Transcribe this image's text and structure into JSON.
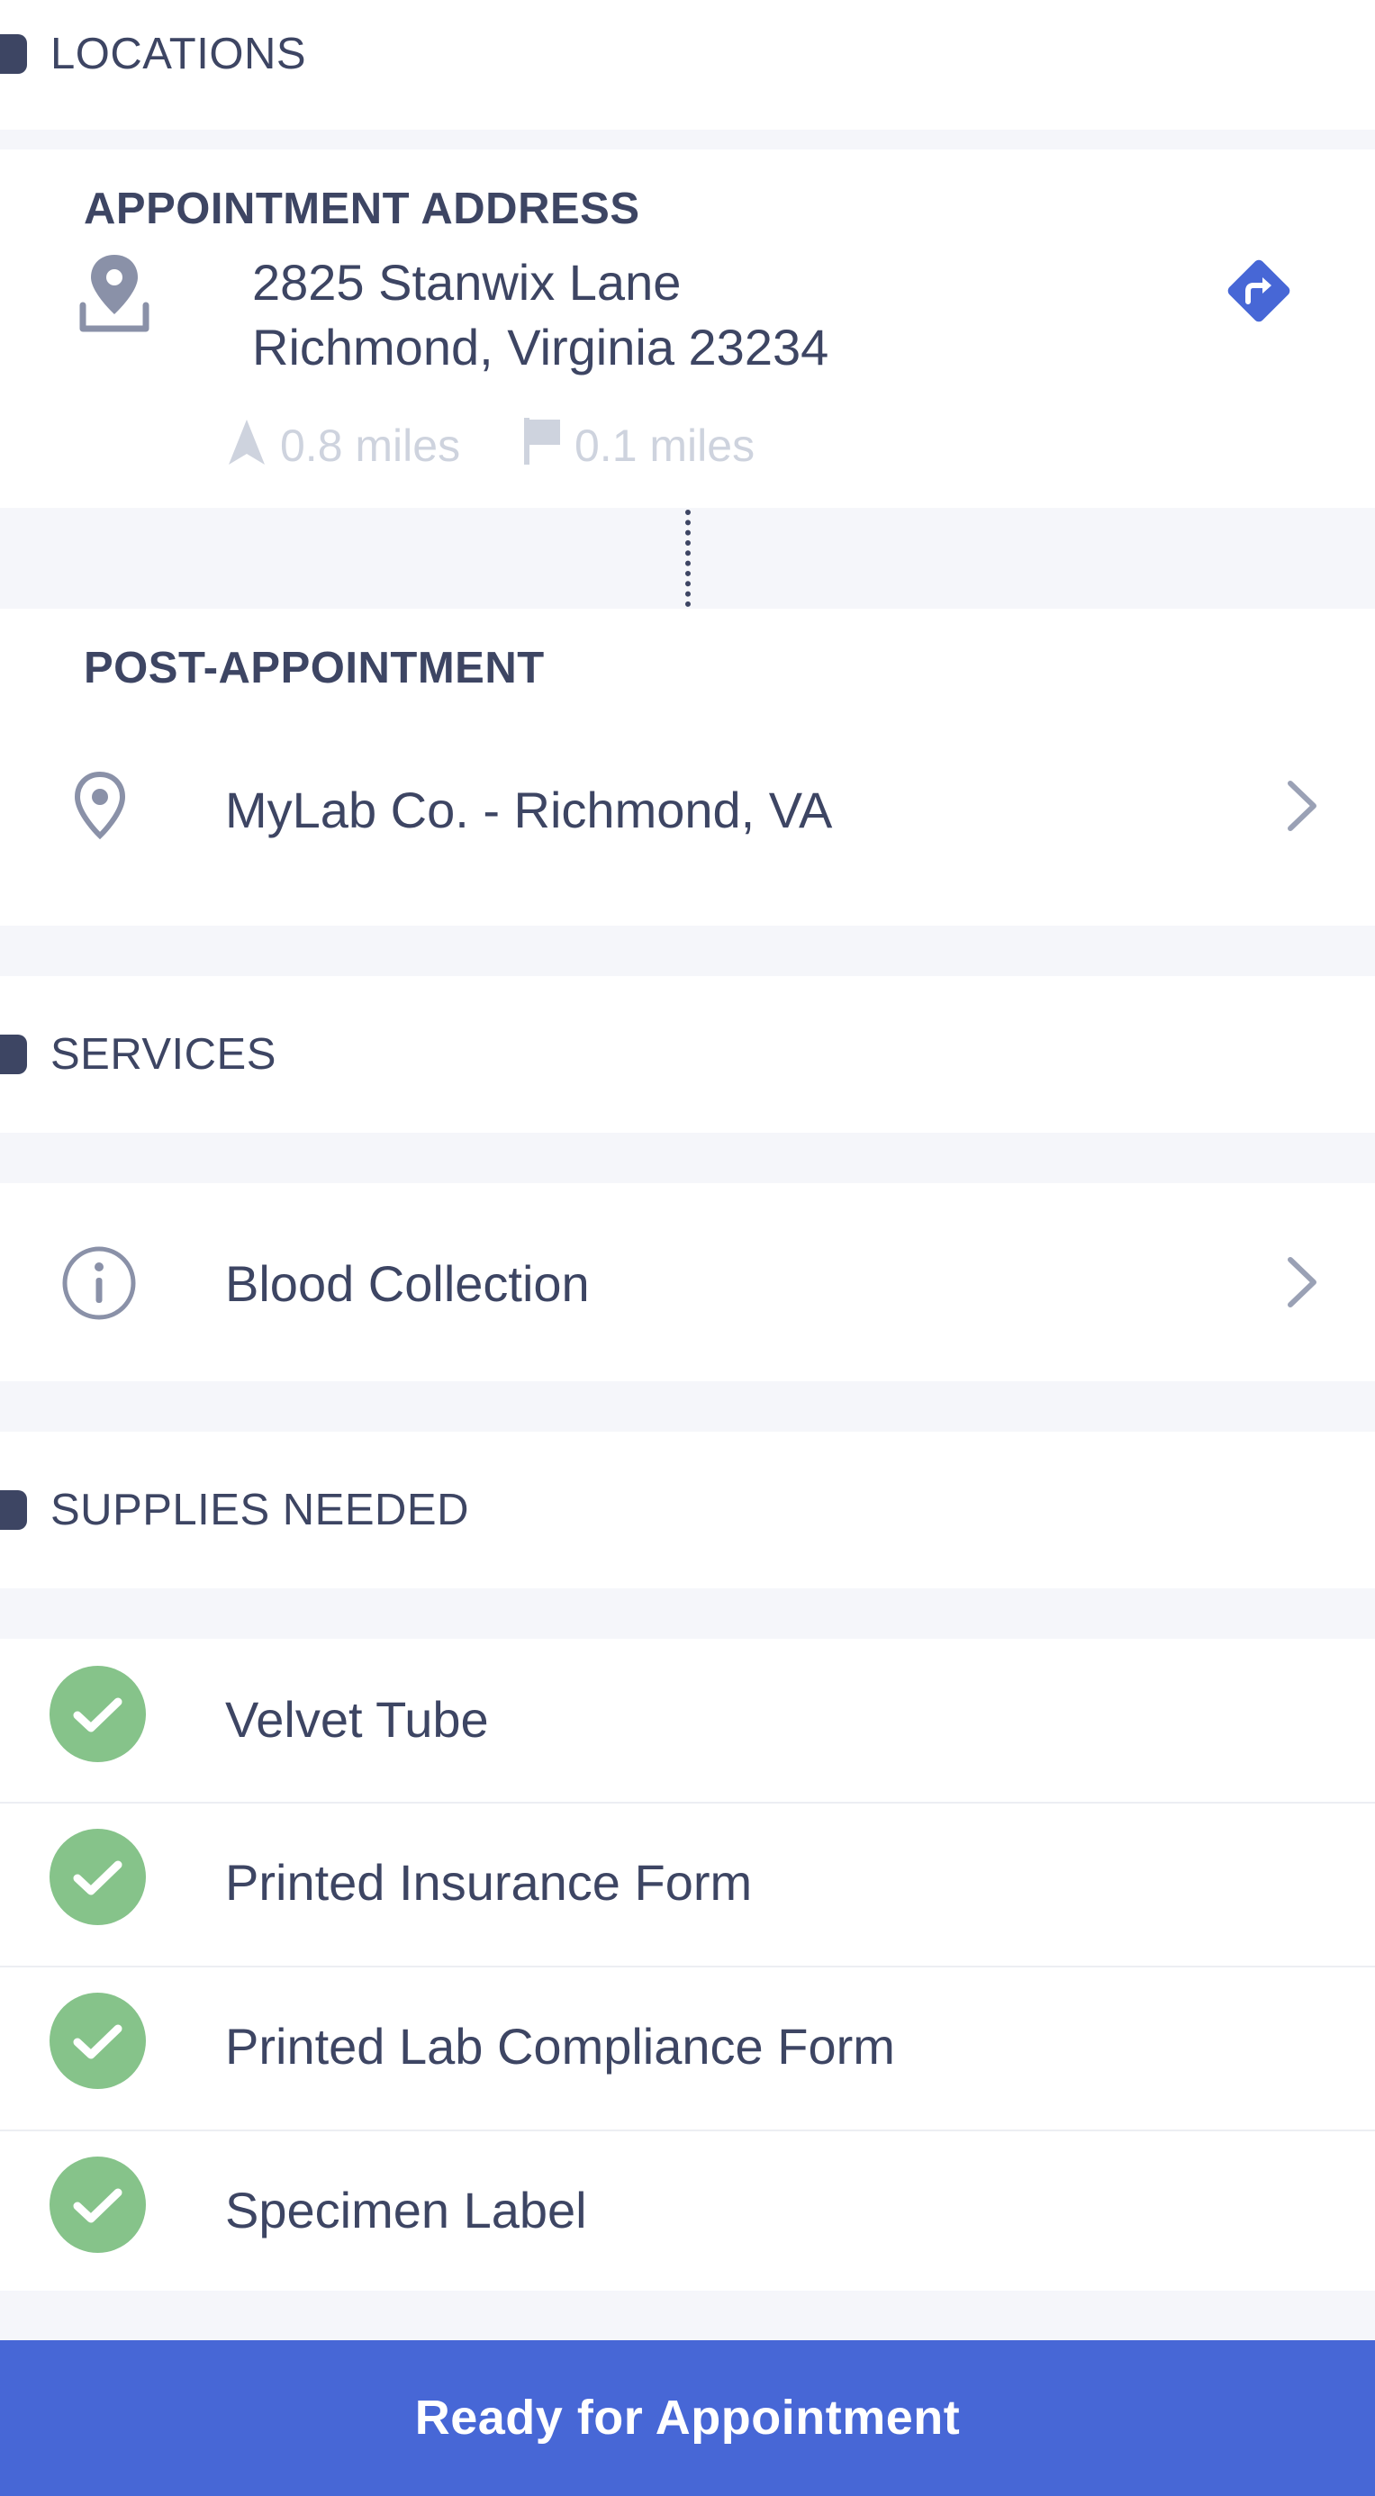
{
  "colors": {
    "accent": "#4767d6",
    "check": "#86c38a",
    "text": "#3d4563",
    "muted": "#ced3de"
  },
  "locations": {
    "section_title": "LOCATIONS",
    "appointment": {
      "heading": "APPOINTMENT ADDRESS",
      "line1": "2825 Stanwix Lane",
      "line2": "Richmond, Virginia 23234",
      "distance_from_you": "0.8 miles",
      "distance_to_flag": "0.1 miles",
      "icon": "location-pin-icon",
      "action_icon": "directions-icon"
    },
    "post": {
      "heading": "POST-APPOINTMENT",
      "label": "MyLab Co. - Richmond, VA",
      "icon": "map-pin-icon"
    }
  },
  "services": {
    "section_title": "SERVICES",
    "items": [
      {
        "label": "Blood Collection",
        "icon": "info-icon"
      }
    ]
  },
  "supplies": {
    "section_title": "SUPPLIES NEEDED",
    "items": [
      {
        "label": "Velvet Tube",
        "checked": true
      },
      {
        "label": "Printed Insurance Form",
        "checked": true
      },
      {
        "label": "Printed Lab Compliance Form",
        "checked": true
      },
      {
        "label": "Specimen Label",
        "checked": true
      }
    ]
  },
  "footer": {
    "cta_label": "Ready for Appointment"
  }
}
